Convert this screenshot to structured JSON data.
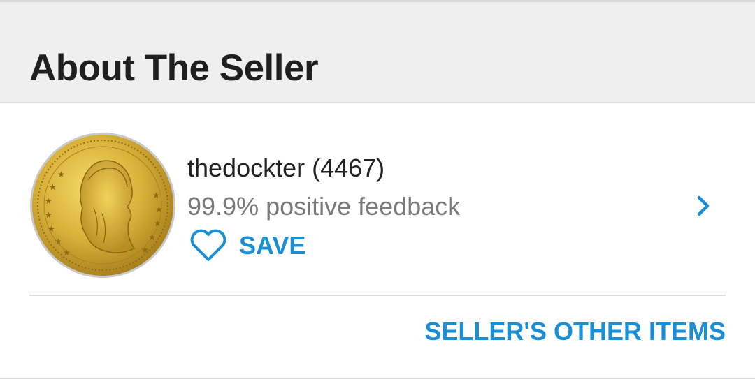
{
  "header": {
    "title": "About The Seller"
  },
  "seller": {
    "avatar_icon": "coin-avatar-icon",
    "name_with_score": "thedockter (4467)",
    "feedback": "99.9% positive feedback",
    "save_label": "SAVE",
    "save_icon": "heart-icon",
    "details_icon": "chevron-right-icon"
  },
  "footer": {
    "other_items_label": "SELLER'S OTHER ITEMS"
  },
  "colors": {
    "accent": "#1a8fd6",
    "header_bg": "#efefef",
    "text_primary": "#222222",
    "text_secondary": "#7a7a7a"
  }
}
